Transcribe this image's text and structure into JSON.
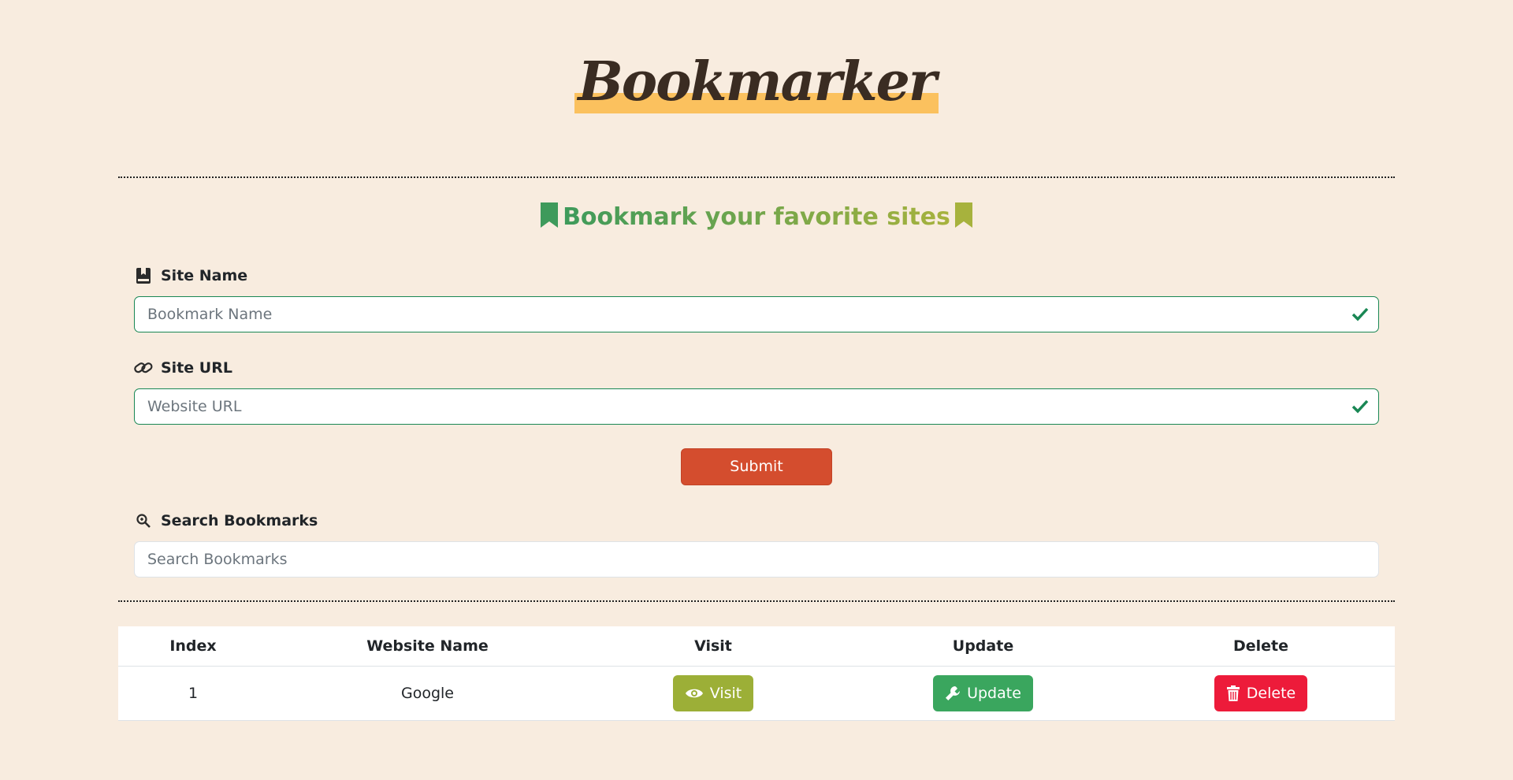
{
  "logo": "Bookmarker",
  "tagline": "Bookmark your favorite sites",
  "form": {
    "site_name_label": "Site Name",
    "site_name_placeholder": "Bookmark Name",
    "site_url_label": "Site URL",
    "site_url_placeholder": "Website URL",
    "submit_label": "Submit",
    "search_label": "Search Bookmarks",
    "search_placeholder": "Search Bookmarks"
  },
  "table": {
    "headers": [
      "Index",
      "Website Name",
      "Visit",
      "Update",
      "Delete"
    ],
    "rows": [
      {
        "index": "1",
        "name": "Google",
        "visit": "Visit",
        "update": "Update",
        "delete": "Delete"
      }
    ]
  },
  "icons": {
    "site_name": "book-bookmark-icon",
    "site_url": "link-icon",
    "search": "magnifier-icon",
    "valid": "check-icon",
    "visit": "eye-icon",
    "update": "wrench-icon",
    "delete": "trash-icon",
    "tagline": "bookmark-icon"
  },
  "colors": {
    "background": "#f8ecdf",
    "logo_highlight": "#fbc15e",
    "submit": "#d44d2e",
    "visit": "#9caf37",
    "update": "#3aa65e",
    "delete": "#ed1b3a",
    "valid": "#198754"
  }
}
